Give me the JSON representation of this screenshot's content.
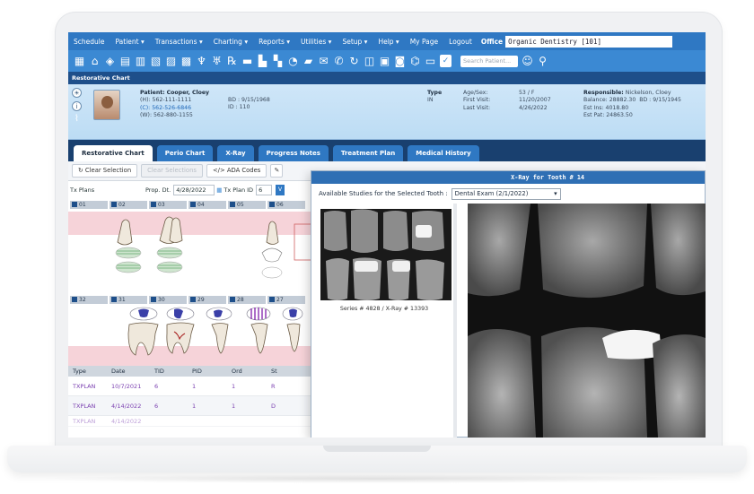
{
  "menu": {
    "items": [
      "Schedule",
      "Patient",
      "Transactions",
      "Charting",
      "Reports",
      "Utilities",
      "Setup",
      "Help",
      "My Page",
      "Logout"
    ],
    "office_label": "Office",
    "office_value": "Organic Dentistry [101]"
  },
  "toolbar": {
    "icons": [
      "calendar-icon",
      "home-icon",
      "navigate-icon",
      "chart-icon",
      "ledger-icon",
      "insurance-icon",
      "pn-icon",
      "tx-icon",
      "perio-icon",
      "tooth-icon",
      "rx-icon",
      "document-icon",
      "print-icon",
      "letter-icon",
      "clock-icon",
      "message-icon",
      "sms-icon",
      "email-icon",
      "refresh-icon",
      "layout-icon",
      "batch-icon",
      "camera-icon",
      "bank-icon",
      "fax-icon",
      "checkbox-icon"
    ],
    "search_placeholder": "Search Patient...",
    "user_icon": "user-search-icon",
    "find_icon": "find-icon"
  },
  "section_title": "Restorative Chart",
  "patient": {
    "name_label": "Patient:",
    "name": "Cooper, Cloey",
    "home_phone": "(H): 562-111-1111",
    "cell_phone": "(C): 562-526-6846",
    "work_phone": "(W): 562-880-1155",
    "birthdate": "BD : 9/15/1968",
    "id": "ID : 110",
    "type_label": "Type",
    "type_value": "IN",
    "age_sex_label": "Age/Sex:",
    "age_sex": "53 / F",
    "first_visit_label": "First Visit:",
    "first_visit": "11/20/2007",
    "last_visit_label": "Last Visit:",
    "last_visit": "4/26/2022",
    "responsible_label": "Responsible:",
    "responsible": "Nickelson, Cloey",
    "balance": "Balance: 28882.30",
    "resp_bd": "BD : 9/15/1945",
    "est_ins": "Est Ins:  4018.80",
    "est_pat": "Est Pat: 24863.50"
  },
  "tabs": [
    "Restorative Chart",
    "Perio Chart",
    "X-Ray",
    "Progress Notes",
    "Treatment Plan",
    "Medical History"
  ],
  "actions": {
    "clear_selection": "Clear Selection",
    "clear_selections_disabled": "Clear Selections",
    "ada_codes": "ADA Codes"
  },
  "txplan": {
    "label": "Tx Plans",
    "prop_dt_label": "Prop. Dt.",
    "prop_dt": "4/28/2022",
    "tx_plan_id_label": "Tx Plan ID",
    "tx_plan_id": "6"
  },
  "teeth_upper": [
    "01",
    "02",
    "03",
    "04",
    "05",
    "06"
  ],
  "teeth_lower": [
    "32",
    "31",
    "30",
    "29",
    "28",
    "27"
  ],
  "proc_table": {
    "headers": [
      "Type",
      "Date",
      "TID",
      "PID",
      "Ord",
      "St"
    ],
    "rows": [
      [
        "TXPLAN",
        "10/7/2021",
        "6",
        "1",
        "1",
        "R"
      ],
      [
        "TXPLAN",
        "4/14/2022",
        "6",
        "1",
        "1",
        "D"
      ],
      [
        "TXPLAN",
        "4/14/2022",
        "",
        "",
        "",
        ""
      ]
    ]
  },
  "xray": {
    "title": "X-Ray for Tooth # 14",
    "studies_label": "Available Studies for the Selected Tooth :",
    "study_selected": "Dental Exam (2/1/2022)",
    "thumb_caption": "Series # 4828 / X-Ray # 13393"
  }
}
